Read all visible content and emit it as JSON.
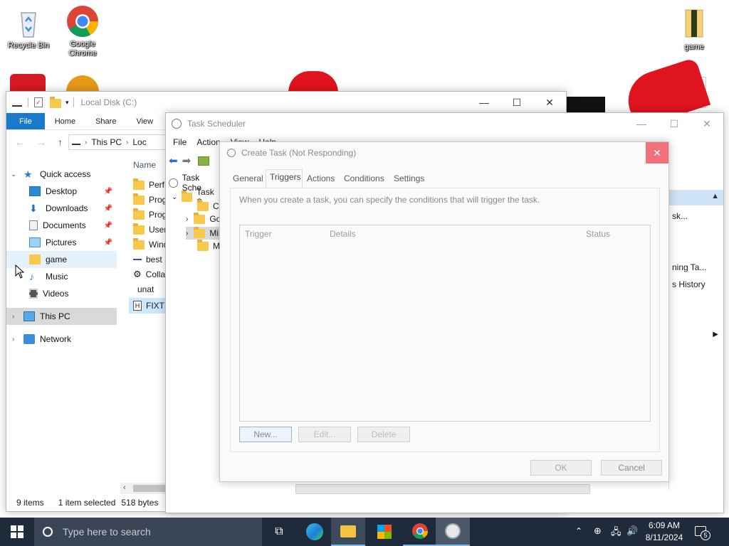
{
  "desktop": {
    "icons": [
      {
        "label": "Recycle Bin"
      },
      {
        "label": "Google Chrome"
      },
      {
        "label": "game"
      }
    ]
  },
  "explorer": {
    "title": "Local Disk (C:)",
    "ribbon_tabs": [
      "File",
      "Home",
      "Share",
      "View"
    ],
    "breadcrumb": [
      "This PC",
      "Loc"
    ],
    "nav": [
      {
        "label": "Quick access"
      },
      {
        "label": "Desktop"
      },
      {
        "label": "Downloads"
      },
      {
        "label": "Documents"
      },
      {
        "label": "Pictures"
      },
      {
        "label": "game"
      },
      {
        "label": "Music"
      },
      {
        "label": "Videos"
      },
      {
        "label": "This PC"
      },
      {
        "label": "Network"
      }
    ],
    "column_name": "Name",
    "files": [
      "PerfL",
      "Prog",
      "Prog",
      "Users",
      "Wind",
      "best",
      "Colla",
      "unat",
      "FIXTH"
    ],
    "status": {
      "count": "9 items",
      "selected": "1 item selected",
      "size": "518 bytes"
    }
  },
  "scheduler": {
    "title": "Task Scheduler",
    "menu": [
      "File",
      "Action",
      "View",
      "Help"
    ],
    "tree": [
      "Task Sche",
      "Task S",
      "CC",
      "Go",
      "Mi",
      "Mi"
    ],
    "right_pane": [
      "sk...",
      "ning Ta...",
      "s History"
    ]
  },
  "dialog": {
    "title": "Create Task (Not Responding)",
    "tabs": [
      "General",
      "Triggers",
      "Actions",
      "Conditions",
      "Settings"
    ],
    "description": "When you create a task, you can specify the conditions that will trigger the task.",
    "columns": [
      "Trigger",
      "Details",
      "Status"
    ],
    "buttons": {
      "new": "New...",
      "edit": "Edit...",
      "delete": "Delete",
      "ok": "OK",
      "cancel": "Cancel"
    }
  },
  "taskbar": {
    "search_placeholder": "Type here to search",
    "time": "6:09 AM",
    "date": "8/11/2024",
    "notifications": "5"
  },
  "colors": {
    "accent": "#1979ca",
    "taskbar": "#1f2b3a",
    "close_red": "#f1707a"
  }
}
